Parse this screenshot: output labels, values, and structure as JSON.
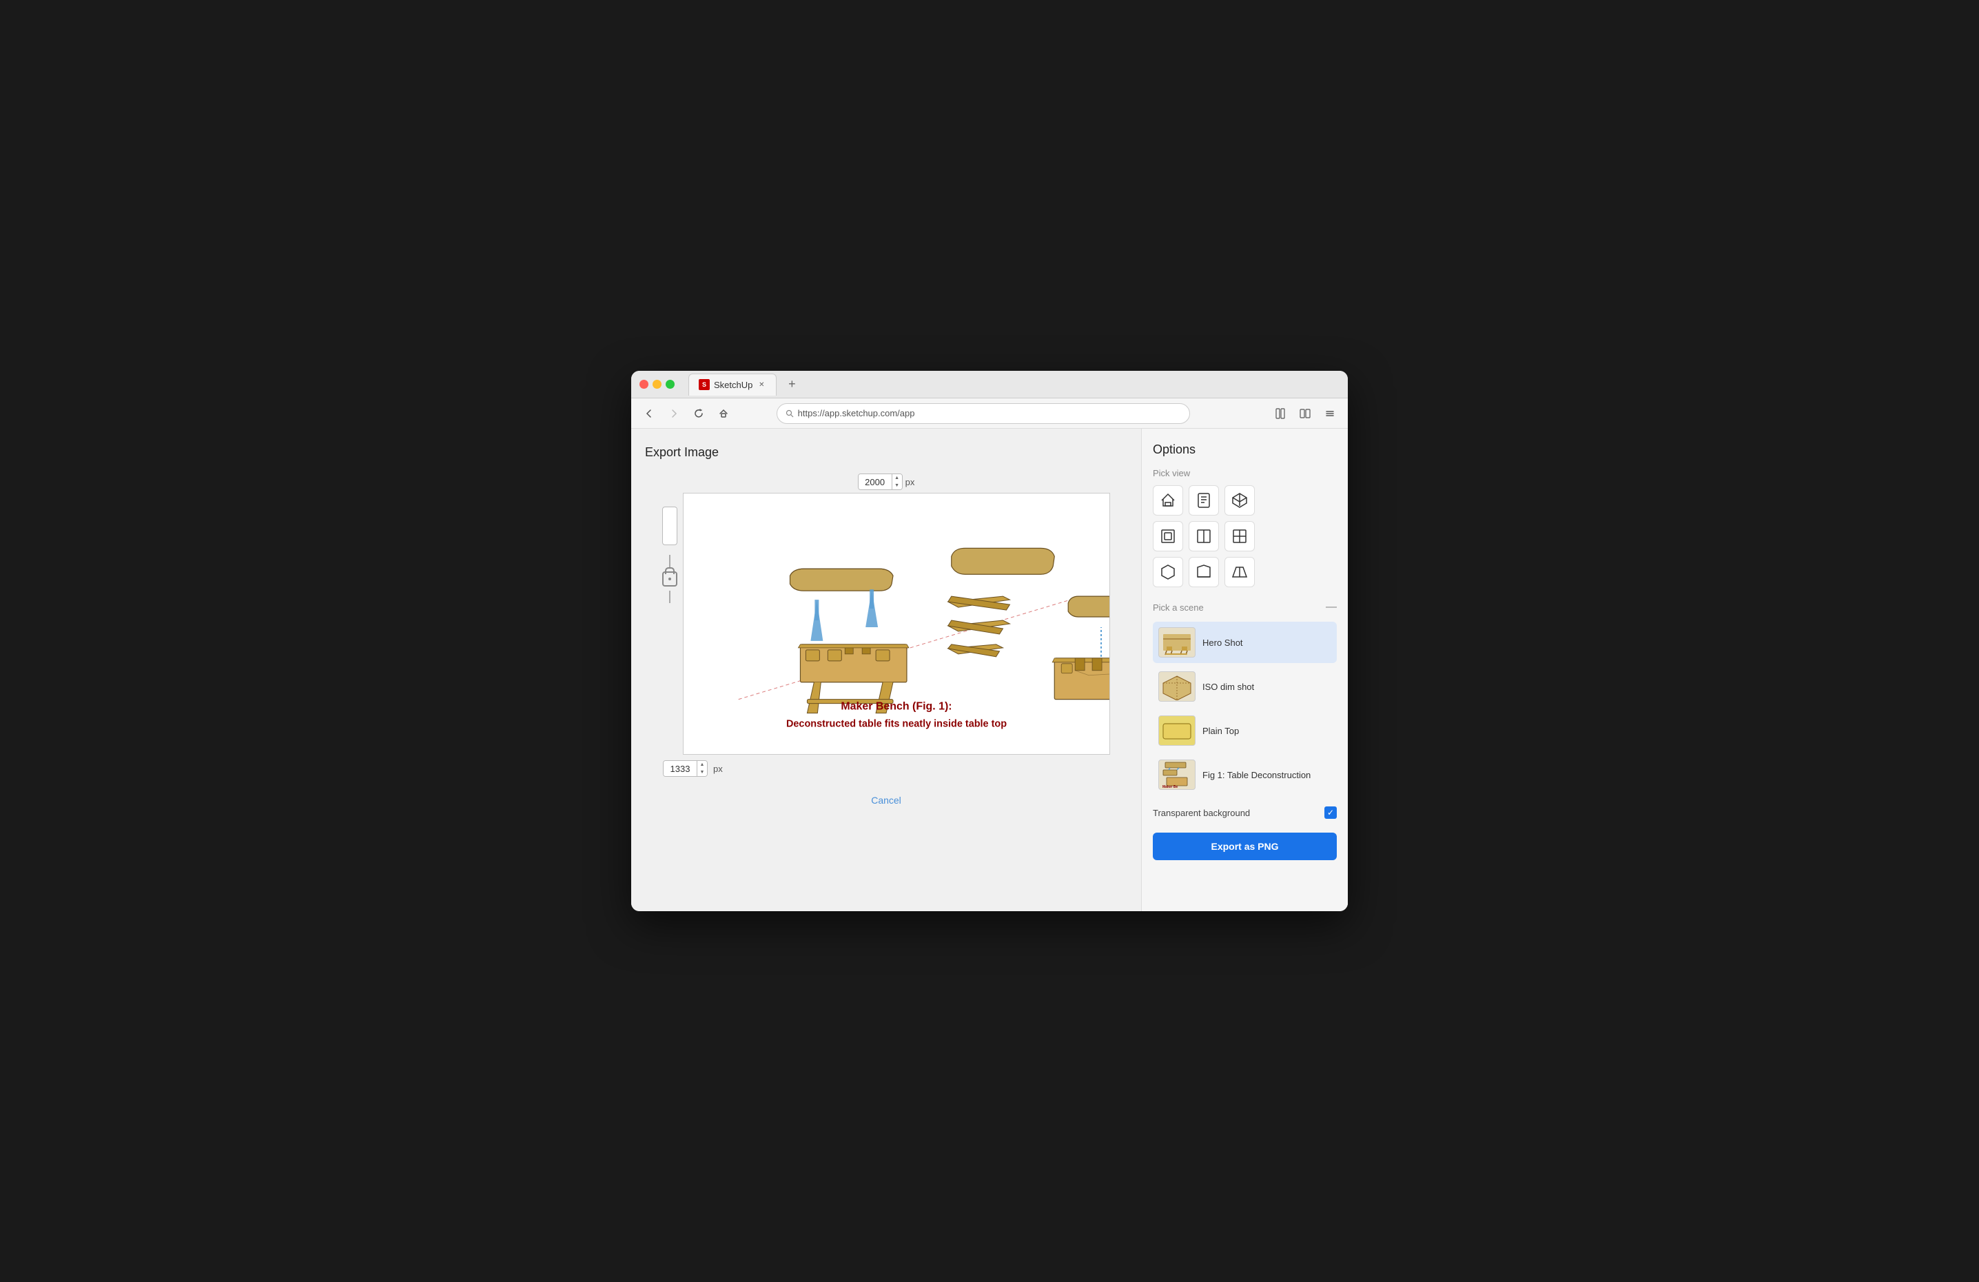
{
  "window": {
    "title": "SketchUp",
    "url": "https://app.sketchup.com/app",
    "tab_label": "SketchUp"
  },
  "export_panel": {
    "title": "Export Image",
    "width_value": "2000",
    "width_unit": "px",
    "height_value": "1333",
    "height_unit": "px",
    "cancel_label": "Cancel",
    "canvas_title_line1": "Maker Bench (Fig. 1):",
    "canvas_title_line2": "Deconstructed table fits neatly inside table top"
  },
  "options_panel": {
    "title": "Options",
    "pick_view_label": "Pick view",
    "pick_scene_label": "Pick a scene",
    "scenes": [
      {
        "id": "hero-shot",
        "name": "Hero Shot",
        "selected": true
      },
      {
        "id": "iso-dim-shot",
        "name": "ISO dim shot",
        "selected": false
      },
      {
        "id": "plain-top",
        "name": "Plain Top",
        "selected": false
      },
      {
        "id": "fig1",
        "name": "Fig 1: Table Deconstruction",
        "selected": false
      }
    ],
    "transparent_bg_label": "Transparent background",
    "transparent_bg_checked": true,
    "export_button_label": "Export as PNG"
  },
  "nav_buttons": {
    "back_title": "Back",
    "forward_title": "Forward",
    "reload_title": "Reload",
    "home_title": "Home"
  }
}
